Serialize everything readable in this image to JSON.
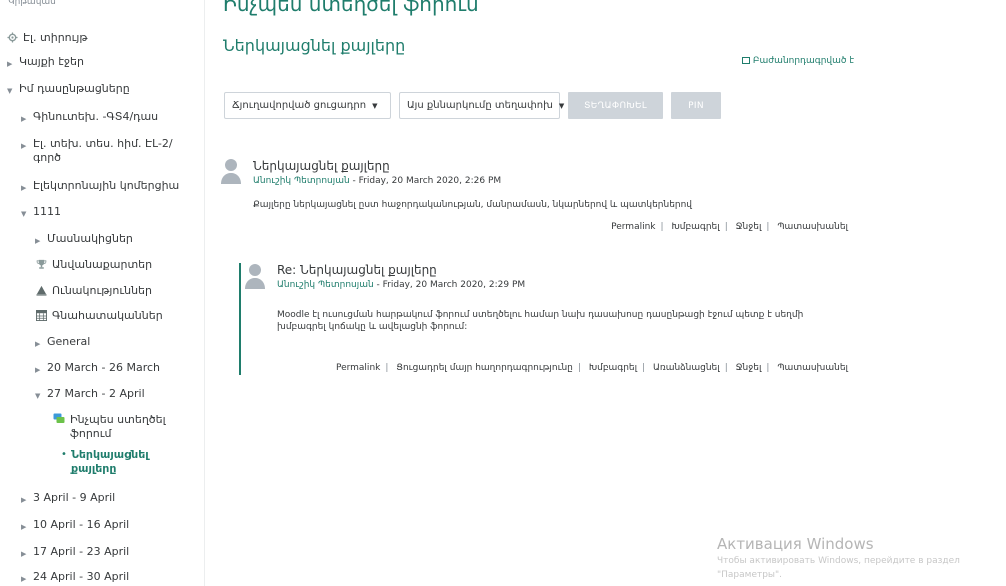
{
  "sidebar": {
    "top_cut": "Կրթական",
    "items": [
      {
        "label": "Էլ. տիրույթ",
        "icon": "gear-icon"
      },
      {
        "label": "Կայքի էջեր",
        "icon": "chevron-right-icon"
      },
      {
        "label": "Իմ դասընթացները",
        "icon": "chevron-down-icon"
      },
      {
        "label": "Գինուտեխ. -ԳՏ4/դաս",
        "icon": "chevron-right-icon"
      },
      {
        "label": "Էլ. տեխ. տես. հիմ. ԷԼ-2/ գործ",
        "icon": "chevron-right-icon"
      },
      {
        "label": "Էլեկտրոնային կոմերցիա",
        "icon": "chevron-right-icon"
      },
      {
        "label": "1111",
        "icon": "chevron-down-icon"
      },
      {
        "label": "Մասնակիցներ",
        "icon": "chevron-right-icon"
      },
      {
        "label": "Անվանաքարտեր",
        "icon": "trophy-icon"
      },
      {
        "label": "Ունակություններ",
        "icon": "competency-icon"
      },
      {
        "label": "Գնահատականներ",
        "icon": "grades-icon"
      },
      {
        "label": "General",
        "icon": "chevron-right-icon"
      },
      {
        "label": "20 March - 26 March",
        "icon": "chevron-right-icon"
      },
      {
        "label": "27 March - 2 April",
        "icon": "chevron-down-icon"
      },
      {
        "label": "Ինչպես ստեղծել ֆորում",
        "icon": "forum-icon"
      },
      {
        "label": "Ներկայացնել քայլերը",
        "icon": "bullet-icon"
      },
      {
        "label": "3 April - 9 April",
        "icon": "chevron-right-icon"
      },
      {
        "label": "10 April - 16 April",
        "icon": "chevron-right-icon"
      },
      {
        "label": "17 April - 23 April",
        "icon": "chevron-right-icon"
      },
      {
        "label": "24 April - 30 April",
        "icon": "chevron-right-icon"
      }
    ]
  },
  "main": {
    "page_title_cut": "Ինչպես ստեղծել ֆորում",
    "discussion_title": "Ներկայացնել քայլերը",
    "subscribed": "Բաժանորդագրված է",
    "display_mode": "Ճյուղավորված ցուցադրո",
    "move_select": "Այս քննարկումը տեղափոխ",
    "move_button": "ՏԵՂԱՓՈԽԵԼ",
    "pin_button": "PIN",
    "post1": {
      "subject": "Ներկայացնել քայլերը",
      "author": "Անուշիկ Պետրոսյան",
      "date": " - Friday, 20 March 2020, 2:26 PM",
      "body": "Քայլերը ներկայացնել ըստ հաջորդականության, մանրամասն, նկարներով և պատկերներով",
      "cmds": [
        "Permalink",
        "Խմբագրել",
        "Ջնջել",
        "Պատասխանել"
      ]
    },
    "post2": {
      "subject": "Re: Ներկայացնել քայլերը",
      "author": "Անուշիկ Պետրոսյան",
      "date": " - Friday, 20 March 2020, 2:29 PM",
      "body": "Moodle էլ ուսուցման հարթակում ֆորում ստեղծելու համար նախ դասախոսը դասընթացի էջում պետք է սեղմի խմբագրել կոճակը և ավելացնի ֆորում:",
      "cmds": [
        "Permalink",
        "Ցուցադրել մայր հաղորդագրությունը",
        "Խմբագրել",
        "Առանձնացնել",
        "Ջնջել",
        "Պատասխանել"
      ]
    }
  },
  "watermark": {
    "title": "Активация Windows",
    "line1": "Чтобы активировать Windows, перейдите в раздел",
    "line2": "\"Параметры\"."
  }
}
